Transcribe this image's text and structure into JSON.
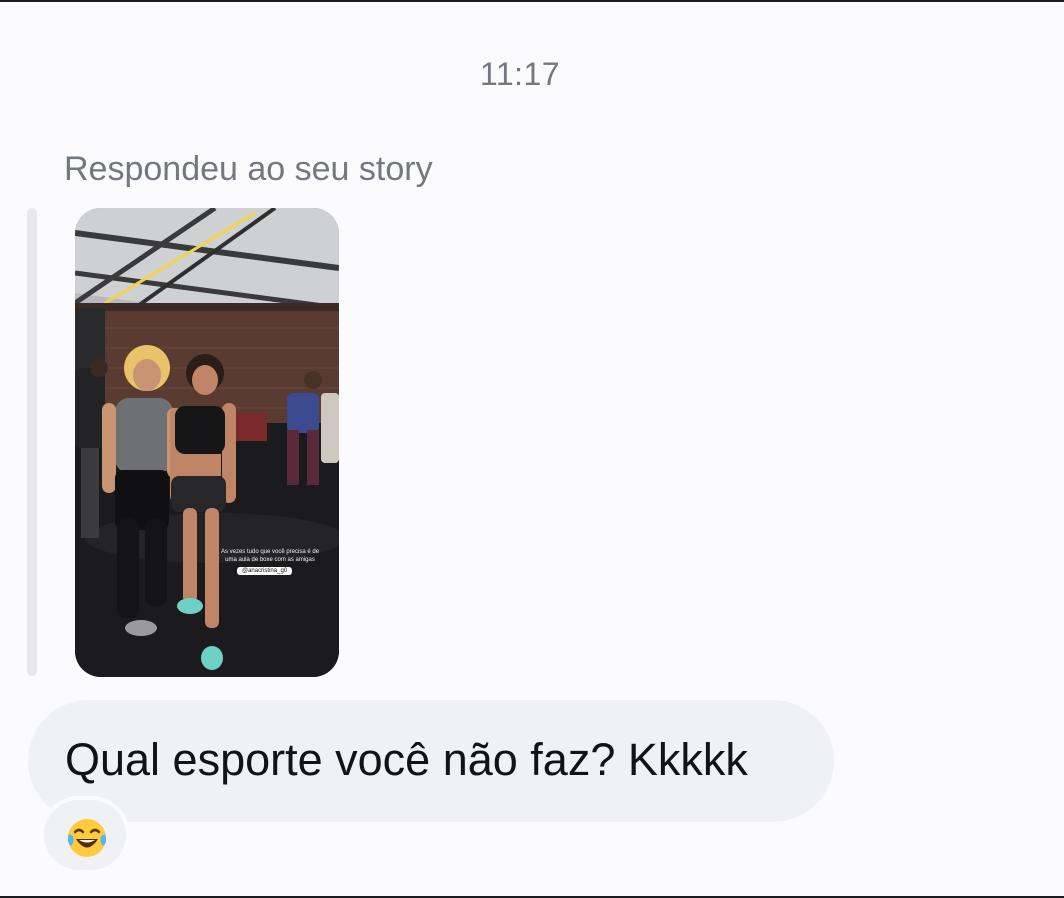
{
  "conversation": {
    "timestamp": "11:17",
    "reply_label": "Respondeu ao seu story",
    "story": {
      "caption": "As vezes tudo que você precisa é de uma aula de boxe com as amigas",
      "tag": "@anacristina_g0"
    },
    "message": {
      "text": "Qual esporte você não faz? Kkkkk"
    },
    "reaction": {
      "emoji_name": "face-with-tears-of-joy-icon"
    }
  },
  "colors": {
    "background": "#fbfbfd",
    "bubble": "#eff1f4",
    "muted_text": "#737780",
    "text": "#111318"
  }
}
